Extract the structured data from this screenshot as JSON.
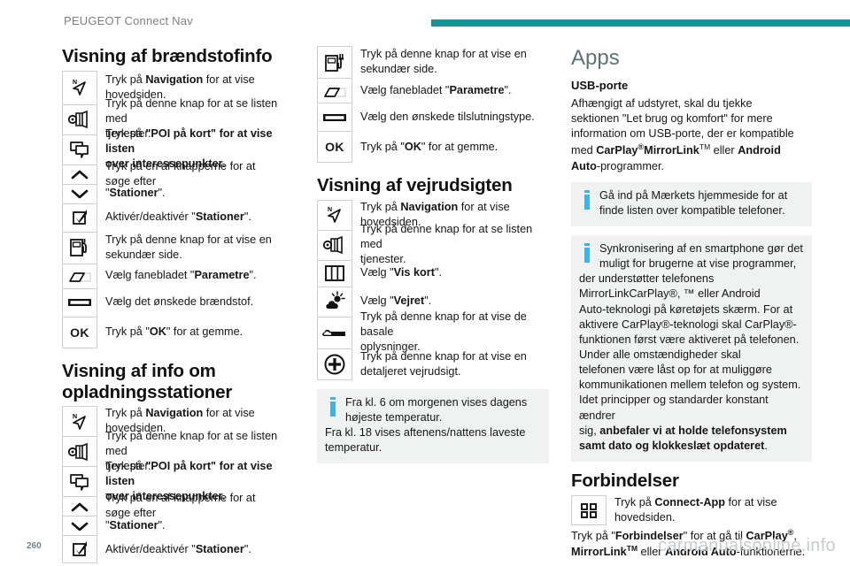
{
  "header": {
    "title": "PEUGEOT Connect Nav",
    "rule_color": "#1a9099"
  },
  "footer": {
    "page_number": "260",
    "watermark": "carmanualsonline.info"
  },
  "colors": {
    "accent_teal": "#1a9099",
    "heading_teal": "#5d7374",
    "info_blue": "#3fb3e3",
    "note_bg": "#f0f2f2"
  },
  "column1": {
    "section1_title": "Visning af brændstofinfo",
    "rows1": [
      {
        "icon": "navigation-arrow-icon",
        "line1_a": "Tryk på ",
        "line1_b": "Navigation",
        "line1_c": " for at vise",
        "line2": "hovedsiden."
      },
      {
        "icon": "services-list-icon",
        "line1": "Tryk på denne knap for at se listen med",
        "line2": "tjenester."
      },
      {
        "icon": "poi-on-map-icon",
        "line1_a": "Tryk på ",
        "line1_b": "\"POI på kort\" for at vise listen",
        "line2_b": "over interessepunkter."
      },
      {
        "icon": "chevron-up-icon",
        "line1": "Tryk på en af knapperne for at søge efter",
        "line2_a": "\"",
        "line2_b": "Stationer",
        "line2_c": "\"."
      },
      {
        "icon": "chevron-down-icon",
        "line1": ""
      },
      {
        "icon": "checkbox-checked-icon",
        "line1_a": "Aktivér/deaktivér \"",
        "line1_b": "Stationer",
        "line1_c": "\"."
      },
      {
        "icon": "fuel-pump-icon",
        "line1": "Tryk på denne knap for at vise en",
        "line2": "sekundær side."
      },
      {
        "icon": "tab-sheet-icon",
        "line1_a": "Vælg fanebladet \"",
        "line1_b": "Parametre",
        "line1_c": "\"."
      },
      {
        "icon": "list-bar-icon",
        "line1": "Vælg det ønskede brændstof."
      },
      {
        "icon": "ok-button-icon",
        "label": "OK",
        "line1_a": "Tryk på \"",
        "line1_b": "OK",
        "line1_c": "\" for at gemme."
      }
    ],
    "section2_title_l1": "Visning af info om",
    "section2_title_l2": "opladningsstationer",
    "rows2": [
      {
        "icon": "navigation-arrow-icon",
        "line1_a": "Tryk på ",
        "line1_b": "Navigation",
        "line1_c": " for at vise",
        "line2": "hovedsiden."
      },
      {
        "icon": "services-list-icon",
        "line1": "Tryk på denne knap for at se listen med",
        "line2": "tjenester."
      },
      {
        "icon": "poi-on-map-icon",
        "line1_a": "Tryk på ",
        "line1_b": "\"POI på kort\" for at vise listen",
        "line2_b": "over interessepunkter."
      },
      {
        "icon": "chevron-up-icon",
        "line1": "Tryk på en af knapperne for at søge efter",
        "line2_a": "\"",
        "line2_b": "Stationer",
        "line2_c": "\"."
      },
      {
        "icon": "chevron-down-icon",
        "line1": ""
      },
      {
        "icon": "checkbox-checked-icon",
        "line1_a": "Aktivér/deaktivér \"",
        "line1_b": "Stationer",
        "line1_c": "\"."
      }
    ]
  },
  "column2": {
    "rows1": [
      {
        "icon": "charging-station-icon",
        "line1": "Tryk på denne knap for at vise en",
        "line2": "sekundær side."
      },
      {
        "icon": "tab-sheet-icon",
        "line1_a": "Vælg fanebladet \"",
        "line1_b": "Parametre",
        "line1_c": "\"."
      },
      {
        "icon": "list-bar-icon",
        "line1": "Vælg den ønskede tilslutningstype."
      },
      {
        "icon": "ok-button-icon",
        "label": "OK",
        "line1_a": "Tryk på \"",
        "line1_b": "OK",
        "line1_c": "\" for at gemme."
      }
    ],
    "section_title": "Visning af vejrudsigten",
    "rows2": [
      {
        "icon": "navigation-arrow-icon",
        "line1_a": "Tryk på ",
        "line1_b": "Navigation",
        "line1_c": " for at vise",
        "line2": "hovedsiden."
      },
      {
        "icon": "services-list-icon",
        "line1": "Tryk på denne knap for at se listen med",
        "line2": "tjenester."
      },
      {
        "icon": "map-icon",
        "line1_a": "Vælg \"",
        "line1_b": "Vis kort",
        "line1_c": "\"."
      },
      {
        "icon": "weather-sun-cloud-icon",
        "line1_a": "Vælg \"",
        "line1_b": "Vejret",
        "line1_c": "\"."
      },
      {
        "icon": "slider-toggle-icon",
        "line1": "Tryk på denne knap for at vise de basale",
        "line2": "oplysninger."
      },
      {
        "icon": "plus-circle-icon",
        "line1": "Tryk på denne knap for at vise en",
        "line2": "detaljeret vejrudsigt."
      }
    ],
    "note": {
      "line1": "Fra kl. 6 om morgenen vises dagens",
      "line2": "højeste temperatur.",
      "line3": "Fra kl. 18 vises aftenens/nattens laveste",
      "line4": "temperatur."
    }
  },
  "column3": {
    "title": "Apps",
    "subtitle": "USB-porte",
    "intro": {
      "l1": "Afhængigt af udstyret, skal du tjekke",
      "l2": "sektionen \"Let brug og komfort\" for mere",
      "l3": "information om USB-porte, der er kompatible",
      "l4_a": "med ",
      "l4_b": "CarPlay",
      "l4_sup": "®",
      "l4_c": "MirrorLink",
      "l4_tm": "TM",
      "l4_d": " eller ",
      "l4_e": "Android",
      "l5_a": "Auto",
      "l5_b": "-programmer."
    },
    "note1": {
      "l1": "Gå ind på Mærkets hjemmeside for at",
      "l2": "finde listen over kompatible telefoner."
    },
    "note2": {
      "l1": "Synkronisering af en smartphone gør det",
      "l2": "muligt for brugerne at vise programmer,",
      "l3": "der understøtter telefonens",
      "l4": "MirrorLinkCarPlay®, ™ eller Android",
      "l5": "Auto-teknologi på køretøjets skærm. For at",
      "l6": "aktivere CarPlay®-teknologi skal CarPlay®-",
      "l7": "funktionen først være aktiveret på telefonen.",
      "l8": "Under alle omstændigheder skal",
      "l9": "telefonen være låst op for at muliggøre",
      "l10": "kommunikationen mellem telefon og system.",
      "l11": "Idet principper og standarder konstant ændrer",
      "l12_a": "sig, ",
      "l12_b": "anbefaler vi at holde telefonsystem",
      "l13_b": "samt dato og klokkeslæt opdateret",
      "l13_c": "."
    },
    "section_title": "Forbindelser",
    "row": {
      "icon": "apps-grid-icon",
      "line1_a": "Tryk på ",
      "line1_b": "Connect-App",
      "line1_c": " for at vise",
      "line2": "hovedsiden."
    },
    "outro": {
      "l1_a": "Tryk på \"",
      "l1_b": "Forbindelser",
      "l1_c": "\" for at gå til ",
      "l1_d": "CarPlay",
      "l1_sup": "®",
      "l1_e": ",",
      "l2_a": "MirrorLink",
      "l2_tm": "TM",
      "l2_b": " eller ",
      "l2_c": "Android Auto",
      "l2_d": "-funktionerne."
    }
  }
}
